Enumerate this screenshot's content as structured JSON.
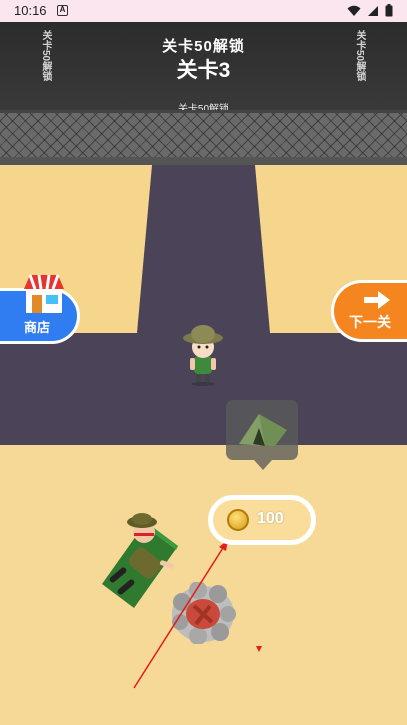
{
  "status_bar": {
    "time": "10:16",
    "app_icon_letter": "A"
  },
  "game": {
    "unlock_text": "关卡50解锁",
    "level_text": "关卡3",
    "fence_text": "关卡50解锁",
    "side_left_text": "关卡50解锁",
    "side_right_text": "关卡50解锁"
  },
  "shop_button": {
    "label": "商店"
  },
  "next_button": {
    "label": "下一关"
  },
  "tent_bubble": {
    "icon": "tent-icon"
  },
  "cost": {
    "value": "100",
    "icon": "coin-icon"
  },
  "colors": {
    "road": "#4b4459",
    "sand": "#f6d68c",
    "shop_blue": "#2f7df0",
    "next_orange": "#f5861f",
    "status_bar": "#fbe5ee"
  }
}
